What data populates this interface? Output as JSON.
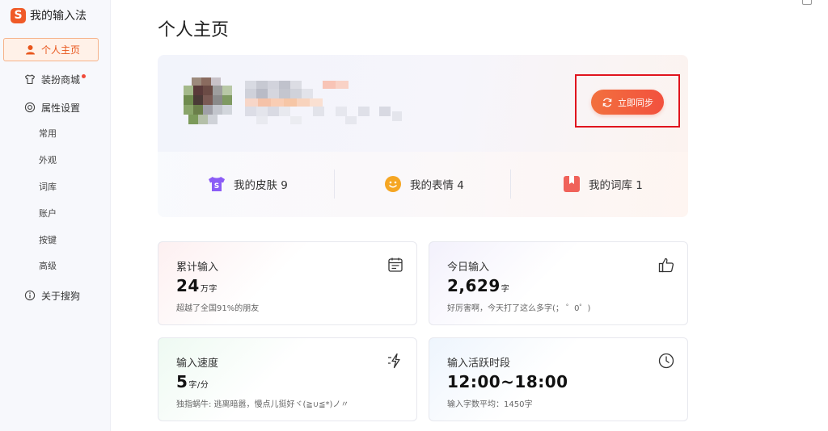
{
  "app": {
    "title": "我的输入法",
    "logo_letter": "S"
  },
  "sidebar": {
    "items": [
      {
        "label": "个人主页",
        "icon": "user-icon",
        "active": true
      },
      {
        "label": "装扮商城",
        "icon": "shirt-icon",
        "badge_dot": true
      },
      {
        "label": "属性设置",
        "icon": "settings-icon"
      },
      {
        "label": "关于搜狗",
        "icon": "info-icon"
      }
    ],
    "subitems": [
      "常用",
      "外观",
      "词库",
      "账户",
      "按键",
      "高级"
    ]
  },
  "page": {
    "title": "个人主页"
  },
  "profile": {
    "sync_label": "立即同步",
    "stats": [
      {
        "label": "我的皮肤 9",
        "icon": "skin-icon",
        "color": "#8b5cf6"
      },
      {
        "label": "我的表情 4",
        "icon": "emoji-icon",
        "color": "#f5a623"
      },
      {
        "label": "我的词库 1",
        "icon": "dictionary-icon",
        "color": "#f0625a"
      }
    ]
  },
  "cards": {
    "total": {
      "label": "累计输入",
      "value": "24",
      "unit": "万字",
      "sub": "超越了全国91%的朋友",
      "icon": "calendar-icon"
    },
    "today": {
      "label": "今日输入",
      "value": "2,629",
      "unit": "字",
      "sub": "好厉害啊，今天打了这么多字(； ゜0゜)",
      "icon": "thumbs-up-icon"
    },
    "speed": {
      "label": "输入速度",
      "value": "5",
      "unit": "字/分",
      "sub": "独指蜗牛: 逃离暗嚣，慢点儿挺好ヾ(≧∪≦*)ノ〃",
      "icon": "lightning-icon"
    },
    "active": {
      "label": "输入活跃时段",
      "value": "12:00~18:00",
      "unit": "",
      "sub": "输入字数平均：1450字",
      "icon": "clock-icon"
    }
  },
  "colors": {
    "accent": "#e8551b",
    "highlight": "#e0141e"
  }
}
